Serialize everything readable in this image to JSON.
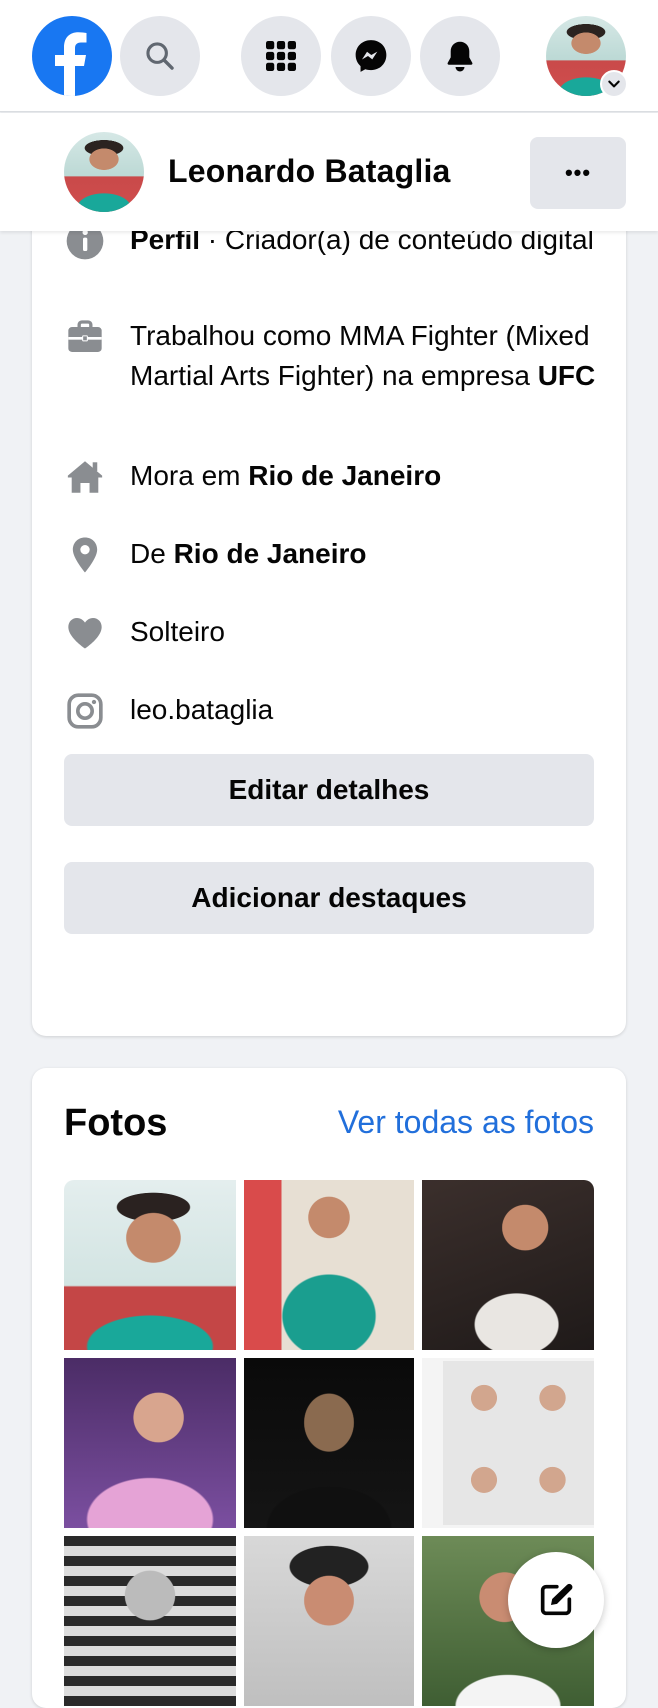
{
  "colors": {
    "brand": "#1877f2",
    "link": "#216fdb",
    "icon_gray": "#8a8d91",
    "button_gray": "#e4e6eb"
  },
  "topnav": {
    "logo_icon": "facebook-f-icon",
    "items": [
      {
        "name": "search",
        "icon": "search-icon"
      },
      {
        "name": "menu",
        "icon": "grid-menu-icon"
      },
      {
        "name": "messenger",
        "icon": "messenger-icon"
      },
      {
        "name": "notifications",
        "icon": "bell-icon"
      },
      {
        "name": "account",
        "icon": "chevron-down-icon"
      }
    ]
  },
  "profile_bar": {
    "name": "Leonardo Bataglia",
    "more_label": "•••"
  },
  "intro": {
    "details": [
      {
        "icon": "info-icon",
        "pre": "",
        "bold": "Perfil",
        "post": " · Criador(a) de conteúdo digital"
      },
      {
        "icon": "briefcase-icon",
        "pre": "Trabalhou como MMA Fighter (Mixed Martial Arts Fighter) na empresa ",
        "bold": "UFC",
        "post": ""
      },
      {
        "icon": "home-icon",
        "pre": "Mora em ",
        "bold": "Rio de Janeiro",
        "post": ""
      },
      {
        "icon": "location-pin-icon",
        "pre": "De ",
        "bold": "Rio de Janeiro",
        "post": ""
      },
      {
        "icon": "heart-icon",
        "pre": "Solteiro",
        "bold": "",
        "post": ""
      },
      {
        "icon": "instagram-icon",
        "link": "leo.bataglia"
      }
    ],
    "edit_details_label": "Editar detalhes",
    "add_highlights_label": "Adicionar destaques"
  },
  "photos": {
    "title": "Fotos",
    "see_all_label": "Ver todas as fotos",
    "count_visible": 9
  },
  "fab": {
    "icon": "compose-icon"
  }
}
